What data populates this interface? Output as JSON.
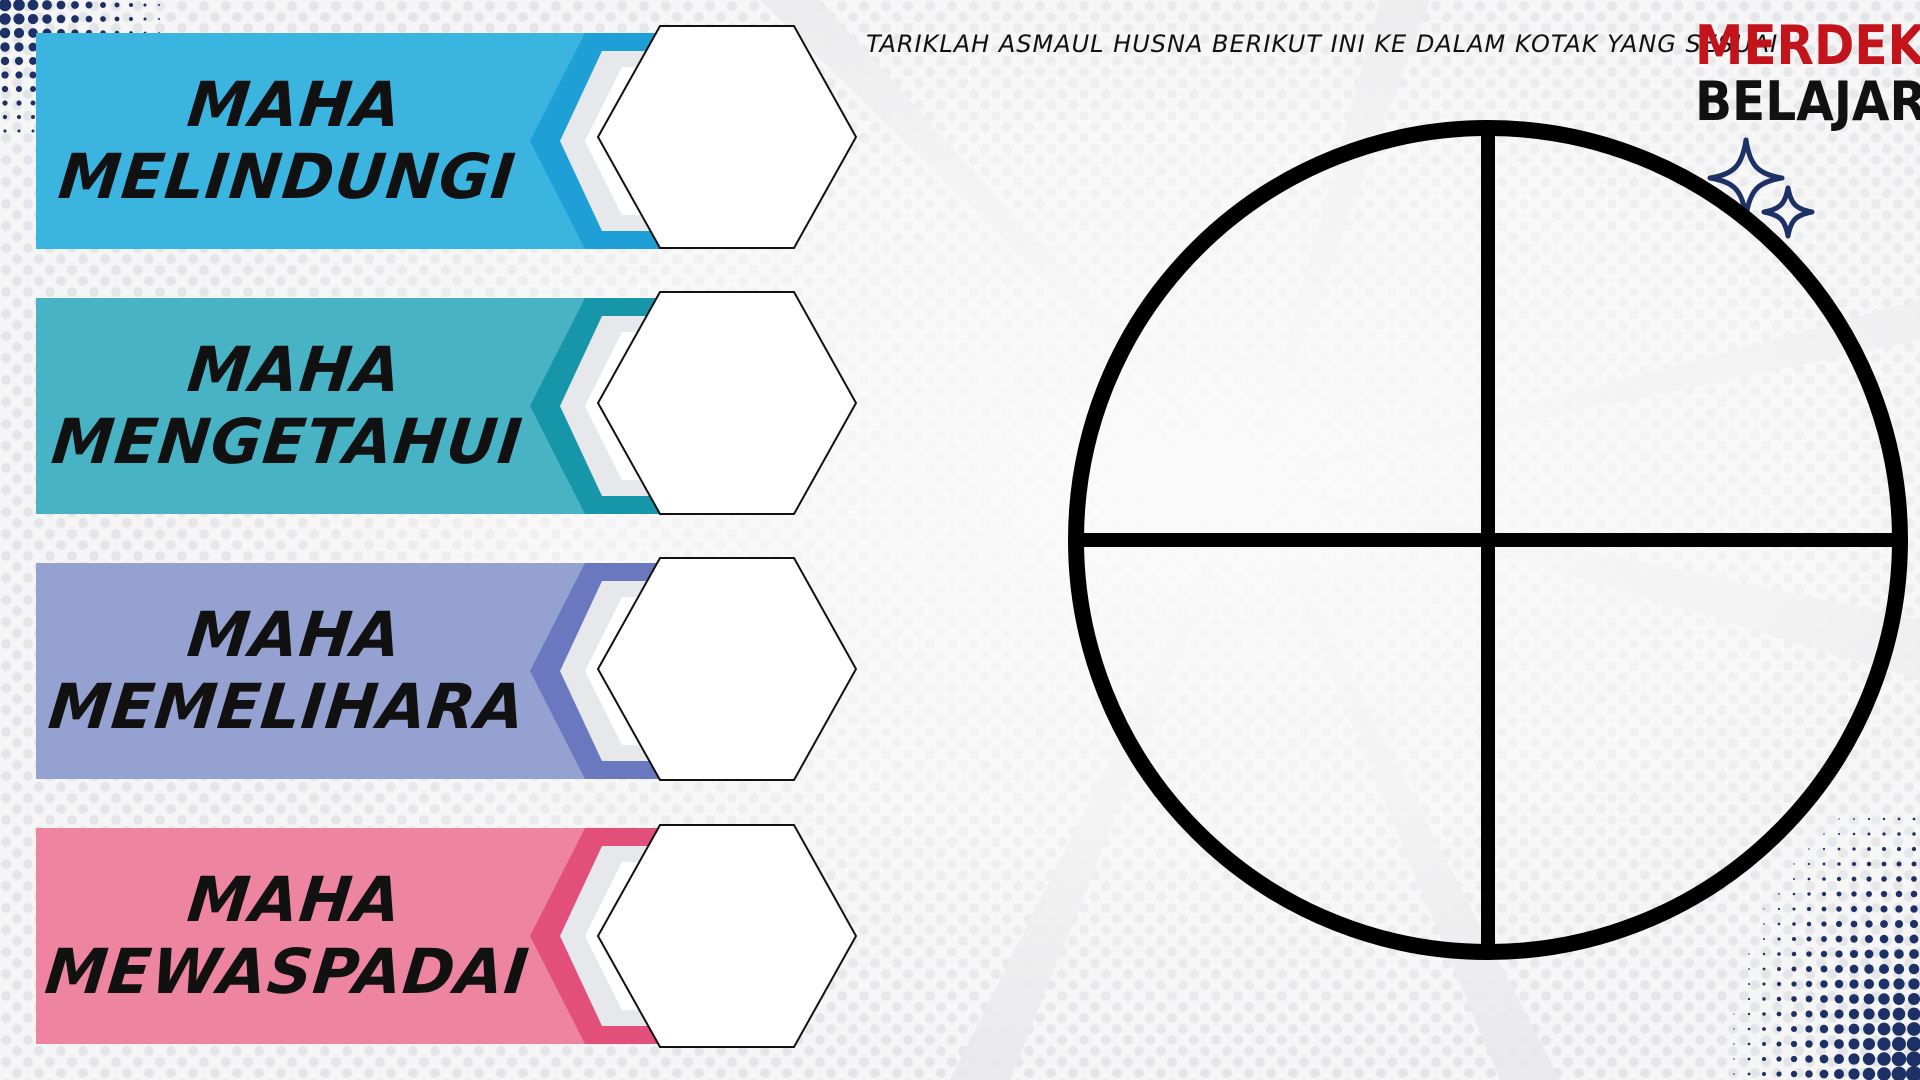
{
  "instruction": "TARIKLAH ASMAUL HUSNA BERIKUT INI KE DALAM KOTAK YANG SESUAI",
  "brand": {
    "line1": "MERDEKA",
    "line2": "BELAJAR"
  },
  "colors": {
    "brand_red": "#c3141b",
    "banner1": "#3bb4e0",
    "banner1_accent": "#1e9fd6",
    "banner2": "#48b3c4",
    "banner2_accent": "#1796aa",
    "banner3": "#95a1d0",
    "banner3_accent": "#6a78c0",
    "banner4": "#ee85a0",
    "banner4_accent": "#e24f7a",
    "halftone": "#1d3166"
  },
  "banners": [
    {
      "line1": "MAHA",
      "line2": "MELINDUNGI"
    },
    {
      "line1": "MAHA",
      "line2": "MENGETAHUI"
    },
    {
      "line1": "MAHA",
      "line2": "MEMELIHARA"
    },
    {
      "line1": "MAHA",
      "line2": "MEWASPADAI"
    }
  ]
}
